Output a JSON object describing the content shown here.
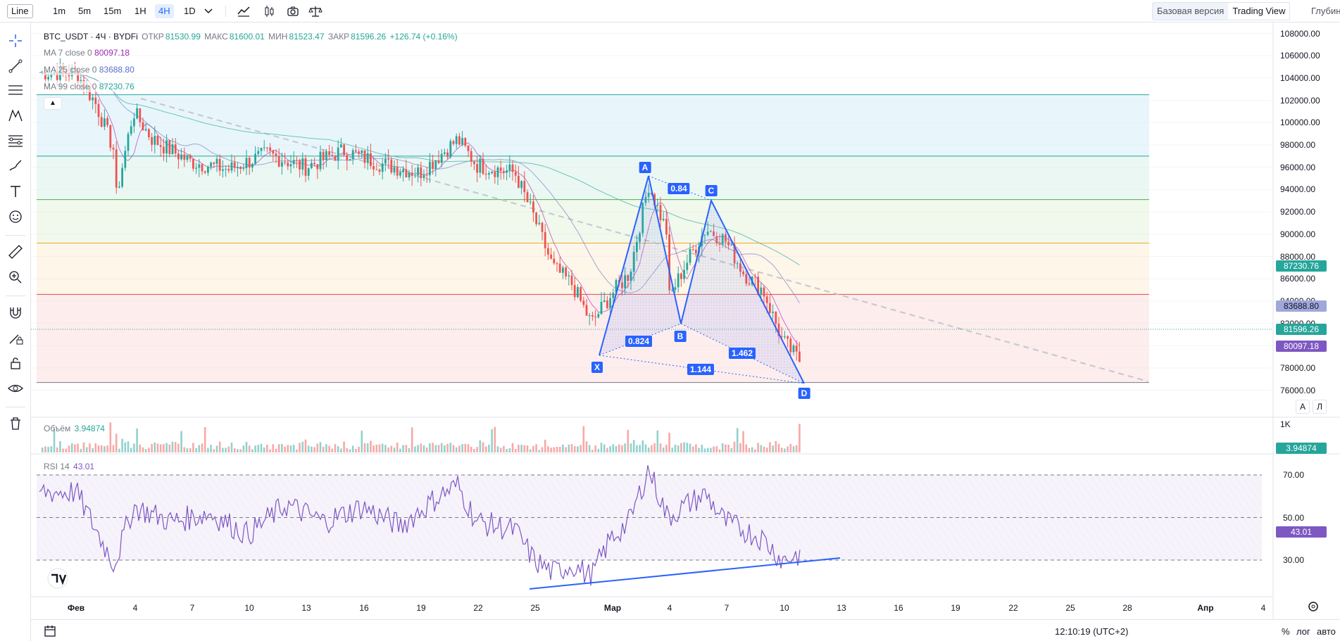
{
  "toolbar": {
    "style_label": "Line",
    "timeframes": [
      "1m",
      "5m",
      "15m",
      "1H",
      "4H",
      "1D"
    ],
    "active_timeframe": "4H",
    "version_basic": "Базовая версия",
    "version_tv": "Trading View",
    "depth_label": "Глубина"
  },
  "legend": {
    "symbol": "BTC_USDT · 4Ч · BYDFi",
    "open_label": "ОТКР",
    "open": "81530.99",
    "high_label": "МАКС",
    "high": "81600.01",
    "low_label": "МИН",
    "low": "81523.47",
    "close_label": "ЗАКР",
    "close": "81596.26",
    "change": "+126.74 (+0.16%)",
    "ma7_label": "MA 7 close 0",
    "ma7_value": "80097.18",
    "ma25_label": "MA 25 close 0",
    "ma25_value": "83688.80",
    "ma99_label": "MA 99 close 0",
    "ma99_value": "87230.76"
  },
  "volume_legend": {
    "label": "Объём",
    "value": "3.94874",
    "axis_label": "1K",
    "tag": "3.94874"
  },
  "rsi_legend": {
    "label": "RSI 14",
    "value": "43.01",
    "tag": "43.01"
  },
  "price_tags": {
    "ma99": "87230.76",
    "ma25": "83688.80",
    "last": "81596.26",
    "ma7": "80097.18"
  },
  "price_axis": [
    "108000.00",
    "106000.00",
    "104000.00",
    "102000.00",
    "100000.00",
    "98000.00",
    "96000.00",
    "94000.00",
    "92000.00",
    "90000.00",
    "88000.00",
    "86000.00",
    "84000.00",
    "82000.00",
    "80000.00",
    "78000.00",
    "76000.00"
  ],
  "rsi_axis": [
    "70.00",
    "50.00",
    "30.00"
  ],
  "x_axis": [
    {
      "label": "Фев",
      "bold": true
    },
    {
      "label": "4"
    },
    {
      "label": "7"
    },
    {
      "label": "10"
    },
    {
      "label": "13"
    },
    {
      "label": "16"
    },
    {
      "label": "19"
    },
    {
      "label": "22"
    },
    {
      "label": "25"
    },
    {
      "label": "Мар",
      "bold": true
    },
    {
      "label": "4"
    },
    {
      "label": "7"
    },
    {
      "label": "10"
    },
    {
      "label": "13"
    },
    {
      "label": "16"
    },
    {
      "label": "19"
    },
    {
      "label": "22"
    },
    {
      "label": "25"
    },
    {
      "label": "28"
    },
    {
      "label": "Апр",
      "bold": true
    },
    {
      "label": "4"
    }
  ],
  "pattern": {
    "points": {
      "X": "X",
      "A": "A",
      "B": "B",
      "C": "C",
      "D": "D"
    },
    "ratios": {
      "xb": "0.824",
      "ac": "0.84",
      "bd": "1.462",
      "xd": "1.144"
    }
  },
  "scale_buttons": {
    "auto": "А",
    "log": "Л"
  },
  "status": {
    "clock": "12:10:19 (UTC+2)",
    "percent": "%",
    "log": "лог",
    "auto": "авто"
  },
  "chart_data": {
    "type": "candlestick",
    "symbol": "BTC_USDT",
    "interval": "4Ч",
    "y_range": [
      75000,
      109000
    ],
    "last_price": 81596.26,
    "moving_averages": [
      {
        "name": "MA 7",
        "value": 80097.18,
        "color": "#9c27b0"
      },
      {
        "name": "MA 25",
        "value": 83688.8,
        "color": "#5b6fc7"
      },
      {
        "name": "MA 99",
        "value": 87230.76,
        "color": "#26a69a"
      }
    ],
    "fib_levels": [
      102500,
      97000,
      93100,
      89200,
      84600,
      76700
    ],
    "close_path": [
      [
        "Фев 1",
        104500
      ],
      [
        "Фев 2",
        101800
      ],
      [
        "Фев 3",
        97500
      ],
      [
        "Фев 3",
        92500
      ],
      [
        "Фев 4",
        101000
      ],
      [
        "Фев 5",
        98500
      ],
      [
        "Фев 7",
        96500
      ],
      [
        "Фев 9",
        95800
      ],
      [
        "Фев 11",
        97200
      ],
      [
        "Фев 13",
        96000
      ],
      [
        "Фев 15",
        97500
      ],
      [
        "Фев 17",
        96300
      ],
      [
        "Фев 19",
        95500
      ],
      [
        "Фев 20",
        97000
      ],
      [
        "Фев 21",
        98500
      ],
      [
        "Фев 22",
        96200
      ],
      [
        "Фев 24",
        95500
      ],
      [
        "Фев 25",
        91500
      ],
      [
        "Фев 26",
        87000
      ],
      [
        "Фев 27",
        85500
      ],
      [
        "Фев 28",
        82000
      ],
      [
        "Мар 1",
        84500
      ],
      [
        "Мар 2",
        86500
      ],
      [
        "Мар 3",
        94500
      ],
      [
        "Мар 4",
        90000
      ],
      [
        "Мар 4",
        84000
      ],
      [
        "Мар 5",
        87500
      ],
      [
        "Мар 6",
        90500
      ],
      [
        "Мар 7",
        89500
      ],
      [
        "Мар 8",
        86500
      ],
      [
        "Мар 9",
        85000
      ],
      [
        "Мар 10",
        80500
      ],
      [
        "Мар 11",
        78500
      ],
      [
        "Мар 11",
        81596
      ]
    ],
    "volume_last": 3.94874,
    "rsi": {
      "period": 14,
      "last": 43.01,
      "levels": [
        70,
        50,
        30
      ],
      "path": [
        [
          "Фев 1",
          62
        ],
        [
          "Фев 2",
          45
        ],
        [
          "Фев 3",
          28
        ],
        [
          "Фев 4",
          55
        ],
        [
          "Фев 6",
          48
        ],
        [
          "Фев 8",
          52
        ],
        [
          "Фев 10",
          42
        ],
        [
          "Фев 12",
          56
        ],
        [
          "Фев 14",
          48
        ],
        [
          "Фев 16",
          55
        ],
        [
          "Фев 18",
          46
        ],
        [
          "Фев 20",
          60
        ],
        [
          "Фев 21",
          65
        ],
        [
          "Фев 22",
          48
        ],
        [
          "Фев 24",
          44
        ],
        [
          "Фев 25",
          30
        ],
        [
          "Фев 26",
          24
        ],
        [
          "Фев 27",
          28
        ],
        [
          "Фев 28",
          22
        ],
        [
          "Мар 1",
          40
        ],
        [
          "Мар 2",
          48
        ],
        [
          "Мар 3",
          73
        ],
        [
          "Мар 4",
          50
        ],
        [
          "Мар 5",
          56
        ],
        [
          "Мар 6",
          61
        ],
        [
          "Мар 7",
          48
        ],
        [
          "Мар 8",
          44
        ],
        [
          "Мар 9",
          40
        ],
        [
          "Мар 10",
          30
        ],
        [
          "Мар 11",
          33
        ],
        [
          "Мар 11",
          43
        ]
      ]
    }
  }
}
